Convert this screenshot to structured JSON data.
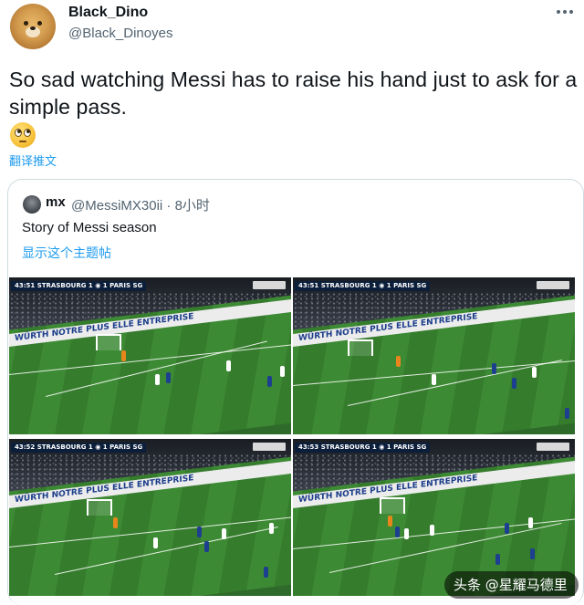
{
  "tweet": {
    "display_name": "Black_Dino",
    "handle": "@Black_Dinoyes",
    "text": "So sad watching Messi has to raise his hand just to ask for a simple pass.",
    "emoji": "face-with-rolling-eyes",
    "translate_label": "翻译推文",
    "more_icon": "more-horizontal-icon"
  },
  "quote": {
    "display_name": "mx",
    "handle": "@MessiMX30ii · 8小时",
    "text": "Story of Messi season",
    "show_thread_label": "显示这个主题帖",
    "frames": [
      {
        "scoreboard": "43:51  STRASBOURG 1 ◉ 1 PARIS SG",
        "ad_board": "WÜRTH    NOTRE PLUS  ELLE ENTREPRISE"
      },
      {
        "scoreboard": "43:51  STRASBOURG 1 ◉ 1 PARIS SG",
        "ad_board": "WÜRTH    NOTRE PLUS  ELLE ENTREPRISE"
      },
      {
        "scoreboard": "43:52  STRASBOURG 1 ◉ 1 PARIS SG",
        "ad_board": "WÜRTH    NOTRE PLUS  ELLE ENTREPRISE"
      },
      {
        "scoreboard": "43:53  STRASBOURG 1 ◉ 1 PARIS SG",
        "ad_board": "WÜRTH    NOTRE PLUS  ELLE ENTREPRISE"
      }
    ]
  },
  "watermark": {
    "text": "头条 @星耀马德里"
  },
  "colors": {
    "link": "#1d9bf0",
    "secondary_text": "#536471",
    "border": "#cfd9de"
  }
}
